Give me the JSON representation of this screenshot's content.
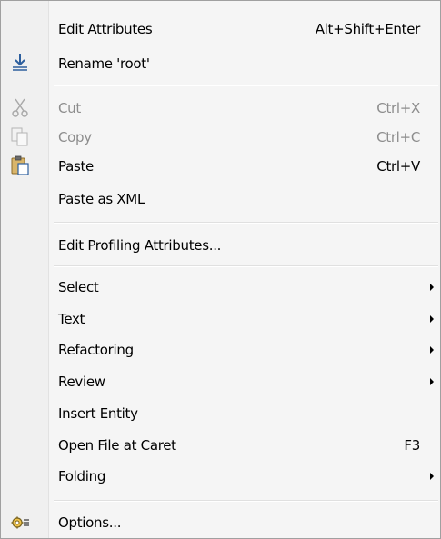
{
  "menu": {
    "edit_attributes": {
      "label": "Edit Attributes",
      "shortcut": "Alt+Shift+Enter"
    },
    "rename": {
      "label": "Rename 'root'"
    },
    "cut": {
      "label": "Cut",
      "shortcut": "Ctrl+X"
    },
    "copy": {
      "label": "Copy",
      "shortcut": "Ctrl+C"
    },
    "paste": {
      "label": "Paste",
      "shortcut": "Ctrl+V"
    },
    "paste_xml": {
      "label": "Paste as XML"
    },
    "edit_profiling": {
      "label": "Edit Profiling Attributes..."
    },
    "select": {
      "label": "Select"
    },
    "text": {
      "label": "Text"
    },
    "refactoring": {
      "label": "Refactoring"
    },
    "review": {
      "label": "Review"
    },
    "insert_entity": {
      "label": "Insert Entity"
    },
    "open_file": {
      "label": "Open File at Caret",
      "shortcut": "F3"
    },
    "folding": {
      "label": "Folding"
    },
    "options": {
      "label": "Options..."
    }
  },
  "icons": {
    "rename": "rename-icon",
    "cut": "scissors-icon",
    "copy": "copy-icon",
    "paste": "clipboard-icon",
    "options": "gear-list-icon"
  },
  "colors": {
    "menu_background": "#f5f5f5",
    "disabled_text": "#8d8d8d",
    "icon_blue": "#2d5f9e",
    "clipboard_brown": "#b28a3c"
  }
}
